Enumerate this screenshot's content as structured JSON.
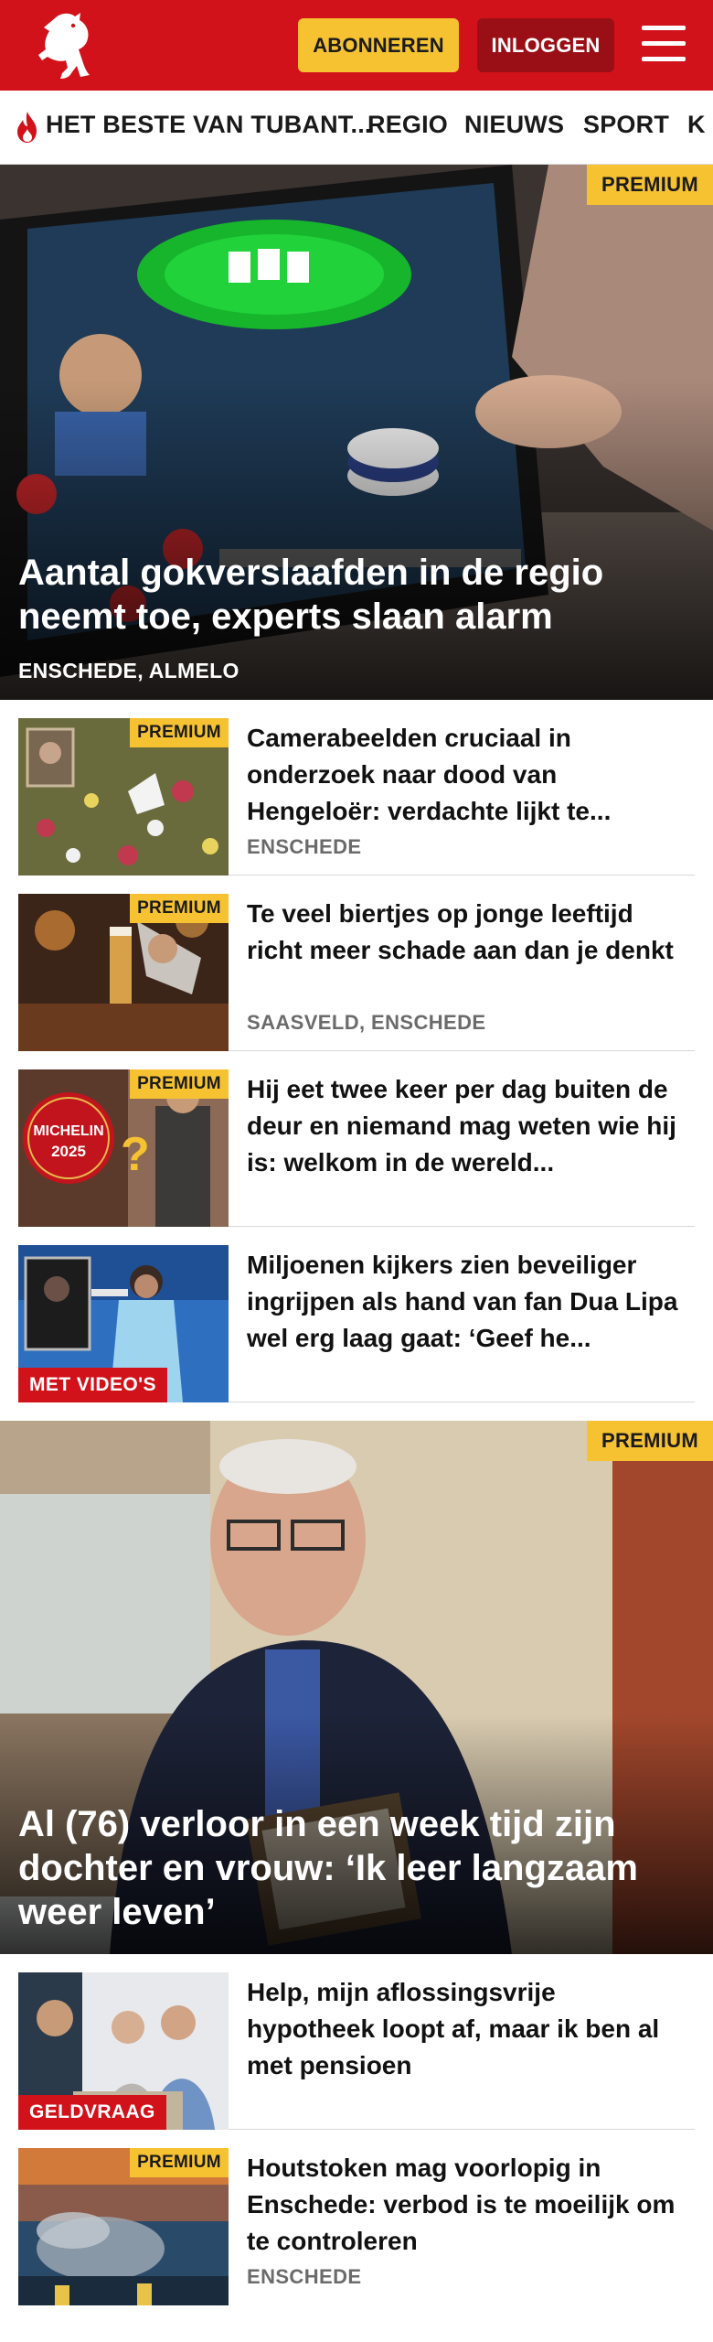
{
  "header": {
    "subscribe_label": "ABONNEREN",
    "login_label": "INLOGGEN",
    "brand_color": "#d2121a",
    "accent_color": "#f6c232"
  },
  "nav": {
    "items": [
      {
        "label": "HET BESTE VAN TUBANT...",
        "icon": "flame-icon"
      },
      {
        "label": "REGIO"
      },
      {
        "label": "NIEUWS"
      },
      {
        "label": "SPORT"
      },
      {
        "label": "K"
      }
    ]
  },
  "hero1": {
    "badge": "PREMIUM",
    "title": "Aantal gokverslaafden in de regio neemt toe, experts slaan alarm",
    "location": "ENSCHEDE, ALMELO"
  },
  "articles": [
    {
      "badge": "PREMIUM",
      "title": "Camerabeelden cruciaal in onderzoek naar dood van Hengeloër: verdachte lijkt te...",
      "location": "ENSCHEDE"
    },
    {
      "badge": "PREMIUM",
      "title": "Te veel biertjes op jonge leeftijd richt meer schade aan dan je denkt",
      "location": "SAASVELD, ENSCHEDE"
    },
    {
      "badge": "PREMIUM",
      "title": "Hij eet twee keer per dag buiten de deur en niemand mag weten wie hij is: welkom in de wereld...",
      "michelin_text": "MICHELIN",
      "michelin_year": "2025"
    },
    {
      "label": "MET VIDEO'S",
      "title": "Miljoenen kijkers zien beveiliger ingrijpen als hand van fan Dua Lipa wel erg laag gaat: ‘Geef he..."
    }
  ],
  "hero2": {
    "badge": "PREMIUM",
    "title": "Al (76) verloor in een week tijd zijn dochter en vrouw: ‘Ik leer langzaam weer leven’"
  },
  "articles2": [
    {
      "label": "GELDVRAAG",
      "title": "Help, mijn aflossingsvrije hypotheek loopt af, maar ik ben al met pensioen"
    },
    {
      "badge": "PREMIUM",
      "title": "Houtstoken mag voorlopig in Enschede: verbod is te moeilijk om te controleren",
      "location": "ENSCHEDE"
    }
  ]
}
